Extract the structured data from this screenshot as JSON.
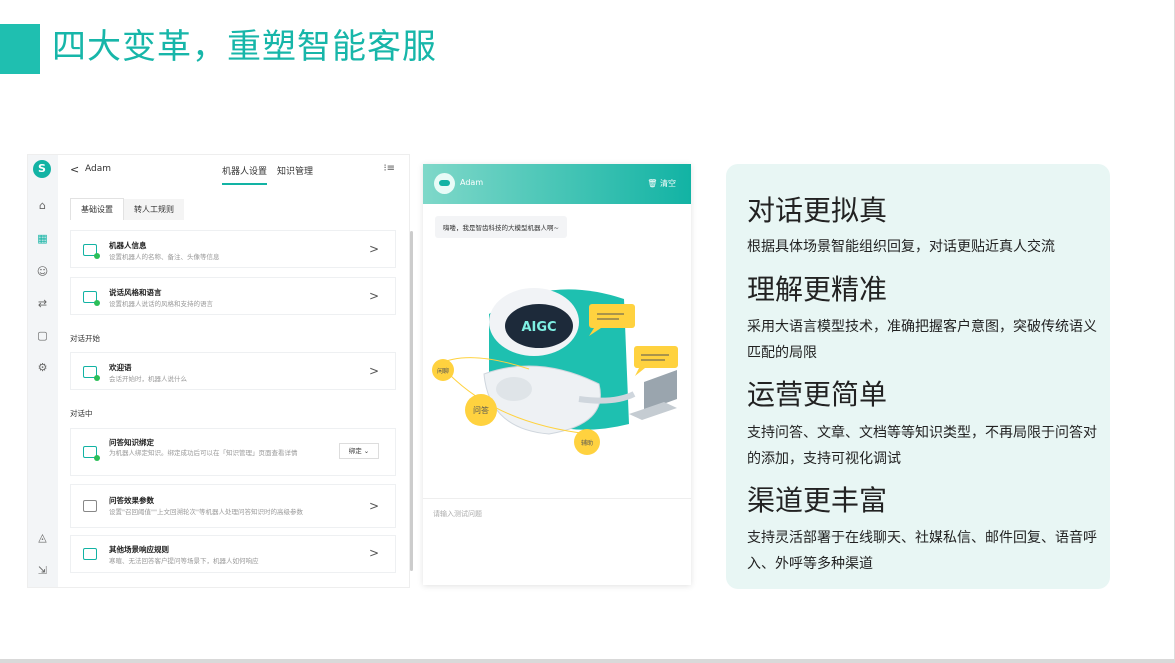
{
  "slide": {
    "title": "四大变革，重塑智能客服"
  },
  "app": {
    "logo": "S",
    "back_symbol": "<",
    "bot_name": "Adam",
    "tabs": [
      "机器人设置",
      "知识管理"
    ],
    "menu_symbol": "⁝≡",
    "subtabs": [
      "基础设置",
      "转人工规则"
    ],
    "rail_icons": [
      "home-icon",
      "apps-icon",
      "robot-icon",
      "flow-icon",
      "book-icon",
      "gear-icon",
      "bell-icon",
      "export-icon"
    ],
    "cards": [
      {
        "title": "机器人信息",
        "desc": "设置机器人的名称、备注、头像等信息"
      },
      {
        "title": "说话风格和语言",
        "desc": "设置机器人说话的风格和支持的语言"
      }
    ],
    "section_start": "对话开始",
    "card_welcome": {
      "title": "欢迎语",
      "desc": "会话开始时，机器人说什么"
    },
    "section_mid": "对话中",
    "card_binding": {
      "title": "问答知识绑定",
      "desc": "为机器人绑定知识。绑定成功后可以在「知识管理」页面查看详情",
      "button": "绑定"
    },
    "card_params": {
      "title": "问答效果参数",
      "desc": "设置\"召回阈值\"\"上文回溯轮次\"等机器人处理问答知识时的高级参数"
    },
    "card_other": {
      "title": "其他场景响应规则",
      "desc": "寒暄、无法回答客户提问等场景下，机器人如何响应"
    },
    "arrow": ">"
  },
  "chat": {
    "bot_name": "Adam",
    "clear_label": "清空",
    "greeting": "嗨喽，我是智齿科技的大模型机器人啊~",
    "ill_badge": "AIGC",
    "ill_labels": [
      "闲聊",
      "问答",
      "辅助"
    ],
    "input_placeholder": "请输入测试问题"
  },
  "features": [
    {
      "title": "对话更拟真",
      "desc": "根据具体场景智能组织回复，对话更贴近真人交流"
    },
    {
      "title": "理解更精准",
      "desc": "采用大语言模型技术，准确把握客户意图，突破传统语义匹配的局限"
    },
    {
      "title": "运营更简单",
      "desc": "支持问答、文章、文档等等知识类型，不再局限于问答对的添加，支持可视化调试"
    },
    {
      "title": "渠道更丰富",
      "desc": "支持灵活部署于在线聊天、社媒私信、邮件回复、语音呼入、外呼等多种渠道"
    }
  ],
  "colors": {
    "accent": "#17b6a9",
    "panel_bg": "#e8f6f4"
  }
}
